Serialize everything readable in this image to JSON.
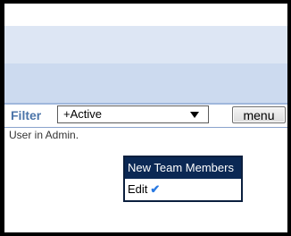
{
  "filter": {
    "label": "Filter",
    "selected": "+Active"
  },
  "menu_button": {
    "label": "menu"
  },
  "status": {
    "text": "User in Admin."
  },
  "dropdown": {
    "items": [
      {
        "label": "New Team Members"
      },
      {
        "label": "Edit",
        "icon": "checkmark-icon",
        "mark": "✔"
      }
    ]
  },
  "colors": {
    "filter_label": "#4b74a9",
    "highlight": "#0b2854",
    "check": "#2a7ae2"
  }
}
